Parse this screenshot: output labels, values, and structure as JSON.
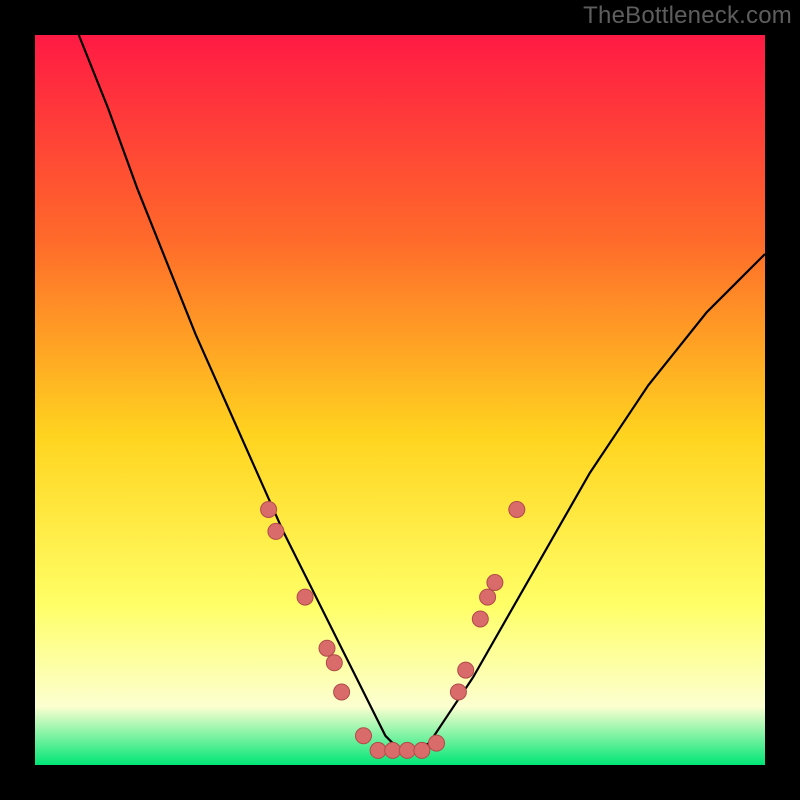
{
  "attribution": "TheBottleneck.com",
  "colors": {
    "frame": "#000000",
    "gradient_top": "#ff1a44",
    "gradient_mid1": "#ff6a2a",
    "gradient_mid2": "#ffd41f",
    "gradient_mid3": "#ffff66",
    "gradient_mid4": "#fcffd0",
    "gradient_bottom": "#00e676",
    "curve": "#000000",
    "marker_fill": "#d96b6b",
    "marker_stroke": "#b24a4a"
  },
  "chart_data": {
    "type": "line",
    "title": "",
    "xlabel": "",
    "ylabel": "",
    "xlim": [
      0,
      100
    ],
    "ylim": [
      0,
      100
    ],
    "curve": {
      "x": [
        6,
        10,
        14,
        18,
        22,
        26,
        30,
        34,
        36,
        38,
        40,
        42,
        44,
        46,
        48,
        50,
        52,
        54,
        56,
        60,
        64,
        68,
        72,
        76,
        80,
        84,
        88,
        92,
        96,
        100
      ],
      "y": [
        100,
        90,
        79,
        69,
        59,
        50,
        41,
        32,
        28,
        24,
        20,
        16,
        12,
        8,
        4,
        2,
        2,
        3,
        6,
        12,
        19,
        26,
        33,
        40,
        46,
        52,
        57,
        62,
        66,
        70
      ]
    },
    "markers": [
      {
        "x": 32,
        "y": 35
      },
      {
        "x": 33,
        "y": 32
      },
      {
        "x": 37,
        "y": 23
      },
      {
        "x": 40,
        "y": 16
      },
      {
        "x": 41,
        "y": 14
      },
      {
        "x": 42,
        "y": 10
      },
      {
        "x": 45,
        "y": 4
      },
      {
        "x": 47,
        "y": 2
      },
      {
        "x": 49,
        "y": 2
      },
      {
        "x": 51,
        "y": 2
      },
      {
        "x": 53,
        "y": 2
      },
      {
        "x": 55,
        "y": 3
      },
      {
        "x": 58,
        "y": 10
      },
      {
        "x": 59,
        "y": 13
      },
      {
        "x": 61,
        "y": 20
      },
      {
        "x": 62,
        "y": 23
      },
      {
        "x": 63,
        "y": 25
      },
      {
        "x": 66,
        "y": 35
      }
    ]
  }
}
